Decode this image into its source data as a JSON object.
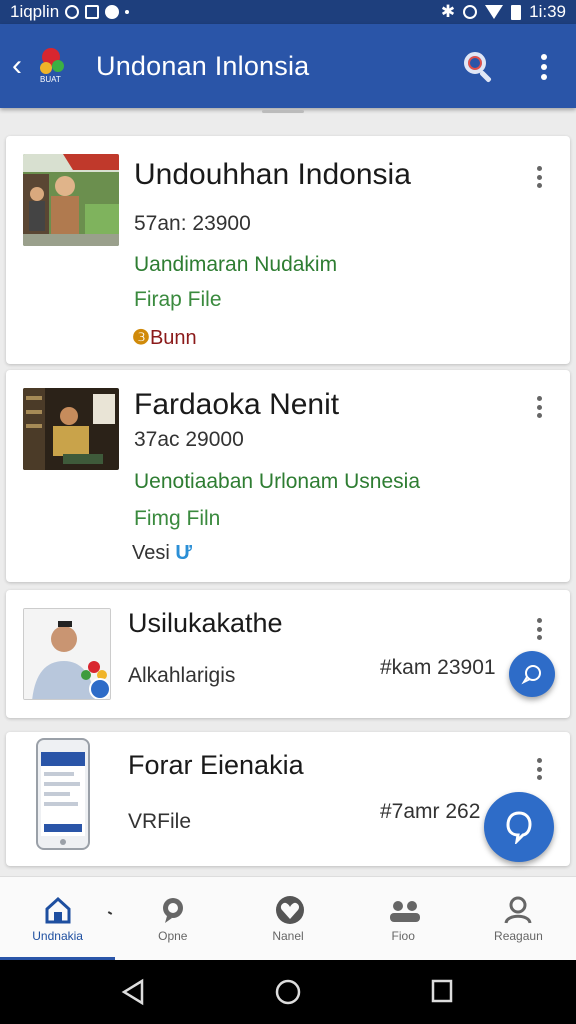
{
  "status_bar": {
    "left_text": "1iqplin",
    "time": "1i:39"
  },
  "app_bar": {
    "title": "Undonan Inlonsia",
    "logo_text": "BUAT"
  },
  "cards": [
    {
      "title": "Undouhhan Indonsia",
      "price": "57an: 23900",
      "subtitle": "Uandimaran Nudakim",
      "file_label": "Firap File",
      "badge": "Bunn"
    },
    {
      "title": "Fardaoka Nenit",
      "price": "37ac 29000",
      "subtitle": "Uenotiaaban Urlonam Usnesia",
      "file_label": "Fimg Filn",
      "badge": "Vesi"
    },
    {
      "title": "Usilukakathe",
      "subtitle": "Alkahlarigis",
      "price": "#kam 23901"
    },
    {
      "title": "Forar Eienakia",
      "file_label": "VRFile",
      "price": "#7amr 262"
    }
  ],
  "bottom_nav": [
    {
      "label": "Undnakia",
      "icon": "home-icon",
      "active": true
    },
    {
      "label": "Opne",
      "icon": "chat-icon",
      "active": false
    },
    {
      "label": "Nanel",
      "icon": "heart-icon",
      "active": false
    },
    {
      "label": "Fioo",
      "icon": "people-icon",
      "active": false
    },
    {
      "label": "Reagaun",
      "icon": "person-icon",
      "active": false
    }
  ],
  "colors": {
    "app_bar": "#2a55a8",
    "accent_green": "#2e7d32",
    "fab": "#2e6cc8"
  }
}
